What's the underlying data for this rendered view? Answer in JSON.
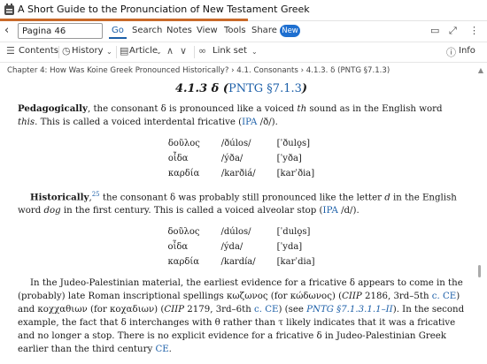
{
  "window": {
    "title": "A Short Guide to the Pronunciation of New Testament Greek"
  },
  "toolbar": {
    "reference_value": "Pagina 46",
    "go": "Go",
    "search": "Search",
    "notes": "Notes",
    "view": "View",
    "tools": "Tools",
    "share": "Share",
    "new_badge": "New"
  },
  "toolbar2": {
    "contents": "Contents",
    "history": "History",
    "article": "Article",
    "link_set": "Link set",
    "info": "Info"
  },
  "breadcrumb": "Chapter 4: How Was Koine Greek Pronounced Historically? › 4.1. Consonants › 4.1.3. δ (PNTG §7.1.3)",
  "content": {
    "heading_num": "4.1.3 δ (",
    "heading_link": "PNTG §7.1.3",
    "heading_end": ")",
    "p1_bold": "Pedagogically",
    "p1_a": ", the consonant δ is pronounced like a voiced ",
    "p1_th": "th",
    "p1_b": " sound as in the English word ",
    "p1_this": "this",
    "p1_c": ". This is called a voiced interdental fricative (",
    "p1_ipa": "IPA",
    "p1_d": " /ð/).",
    "table1": [
      [
        "δοῦλος",
        "/ðúlos/",
        "[ˈðulo̞s]"
      ],
      [
        "οἶδα",
        "/ýða/",
        "[ˈyða]"
      ],
      [
        "καρδία",
        "/karðiá/",
        "[karˈðia]"
      ]
    ],
    "p2_bold": "Historically",
    "p2_sup": "25",
    "p2_a": " the consonant δ was probably still pronounced like the letter ",
    "p2_d": "d",
    "p2_b": " in the English word ",
    "p2_dog": "dog",
    "p2_c": " in the first century. This is called a voiced alveolar stop (",
    "p2_ipa": "IPA",
    "p2_e": " /d/).",
    "table2": [
      [
        "δοῦλος",
        "/dúlos/",
        "[ˈdulo̞s]"
      ],
      [
        "οἶδα",
        "/ýda/",
        "[ˈyda]"
      ],
      [
        "καρδία",
        "/kardía/",
        "[karˈdia]"
      ]
    ],
    "p3_a": "In the Judeo-Palestinian material, the earliest evidence for a fricative δ appears to come in the (probably) late Roman inscriptional spellings κωζωνος (for κώδωνος) (",
    "p3_ciip1": "CIIP",
    "p3_b": " 2186, 3rd–5th ",
    "p3_ce1": "c. CE",
    "p3_c": ") and κοχχαθιων (for κοχαδιων) (",
    "p3_ciip2": "CIIP",
    "p3_d": " 2179, 3rd–6th ",
    "p3_ce2": "c. CE",
    "p3_e": ") (see ",
    "p3_pntg": "PNTG §7.1.3.1.1–II",
    "p3_f": "). In the second example, the fact that δ interchanges with θ rather than τ likely indicates that it was a fricative and no longer a stop. There is no explicit evidence for a frica­tive δ in Judeo-Palestinian Greek earlier than the third century ",
    "p3_ce3": "CE",
    "p3_g": "."
  }
}
